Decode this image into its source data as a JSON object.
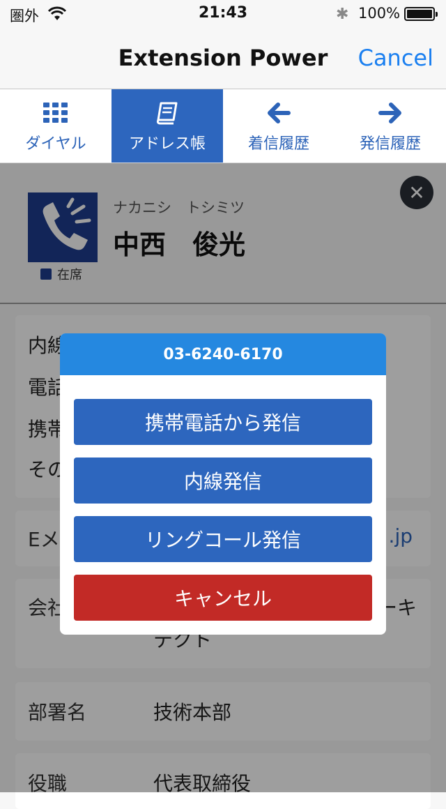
{
  "status_bar": {
    "carrier": "圏外",
    "time": "21:43",
    "battery_percent": "100%"
  },
  "nav": {
    "title": "Extension Power",
    "cancel_label": "Cancel"
  },
  "tabs": [
    {
      "label": "ダイヤル",
      "icon": "keypad-icon"
    },
    {
      "label": "アドレス帳",
      "icon": "address-book-icon",
      "active": true
    },
    {
      "label": "着信履歴",
      "icon": "arrow-left-icon"
    },
    {
      "label": "発信履歴",
      "icon": "arrow-right-icon"
    }
  ],
  "contact": {
    "kana": "ナカニシ　トシミツ",
    "name": "中西　俊光",
    "presence": "在席",
    "fields_partial": [
      "内線",
      "電話",
      "携帯",
      "その"
    ],
    "email_label": "Eメ",
    "email_value_suffix": ".jp",
    "company_label": "会社",
    "company_value_right": "ーキ",
    "company_value_line2": "テクト",
    "department_label": "部署名",
    "department_value": "技術本部",
    "title_label": "役職",
    "title_value": "代表取締役"
  },
  "dialog": {
    "number": "03-6240-6170",
    "buttons": [
      {
        "label": "携帯電話から発信"
      },
      {
        "label": "内線発信"
      },
      {
        "label": "リングコール発信"
      },
      {
        "label": "キャンセル"
      }
    ]
  },
  "colors": {
    "primary_blue": "#2d66be",
    "header_blue": "#2588e0",
    "cancel_red": "#c22a26",
    "link_blue": "#1a7ff0"
  }
}
